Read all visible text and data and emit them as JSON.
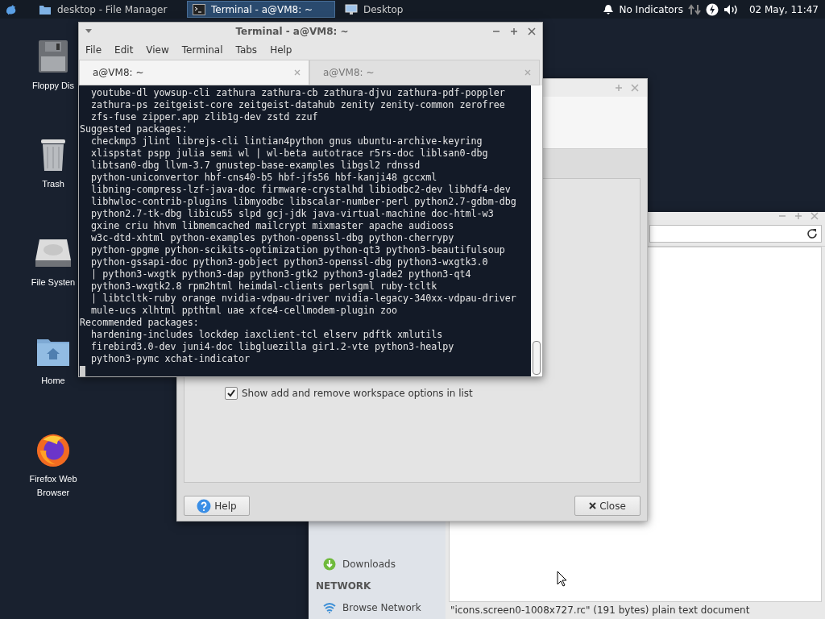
{
  "panel": {
    "tasks": [
      {
        "label": "desktop - File Manager",
        "kind": "folder",
        "selected": false
      },
      {
        "label": "Terminal - a@VM8: ~",
        "kind": "terminal",
        "selected": true
      },
      {
        "label": "Desktop",
        "kind": "desktop",
        "selected": false
      }
    ],
    "indicators": "No Indicators",
    "clock": "02 May, 11:47"
  },
  "desktop_icons": [
    {
      "label": "Floppy Dis",
      "kind": "floppy"
    },
    {
      "label": "Trash",
      "kind": "trash"
    },
    {
      "label": "File Systen",
      "kind": "disk"
    },
    {
      "label": "Home",
      "kind": "home"
    },
    {
      "label": "Firefox Web Browser",
      "kind": "browser"
    }
  ],
  "file_manager": {
    "sidebar": [
      {
        "label": "Downloads",
        "kind": "download"
      },
      {
        "label": "NETWORK",
        "kind": "heading"
      },
      {
        "label": "Browse Network",
        "kind": "network"
      }
    ],
    "status_bar": "\"icons.screen0-1008x727.rc\" (191 bytes) plain text document"
  },
  "settings": {
    "options": [
      {
        "label": "Show add and remove workspace options in list",
        "checked": true
      }
    ],
    "buttons": [
      {
        "label": "Help",
        "kind": "help"
      },
      {
        "label": "Close",
        "kind": "close"
      }
    ]
  },
  "terminal": {
    "title": "Terminal - a@VM8: ~",
    "menu": [
      "File",
      "Edit",
      "View",
      "Terminal",
      "Tabs",
      "Help"
    ],
    "tabs": [
      {
        "label": "a@VM8: ~",
        "selected": true
      },
      {
        "label": "a@VM8: ~",
        "selected": false
      }
    ],
    "lines": [
      "  youtube-dl yowsup-cli zathura zathura-cb zathura-djvu zathura-pdf-poppler",
      "  zathura-ps zeitgeist-core zeitgeist-datahub zenity zenity-common zerofree",
      "  zfs-fuse zipper.app zlib1g-dev zstd zzuf",
      "Suggested packages:",
      "  checkmp3 jlint librejs-cli lintian4python gnus ubuntu-archive-keyring",
      "  xlispstat pspp julia semi wl | wl-beta autotrace r5rs-doc liblsan0-dbg",
      "  libtsan0-dbg llvm-3.7 gnustep-base-examples libgsl2 rdnssd",
      "  python-uniconvertor hbf-cns40-b5 hbf-jfs56 hbf-kanji48 gccxml",
      "  libning-compress-lzf-java-doc firmware-crystalhd libiodbc2-dev libhdf4-dev",
      "  libhwloc-contrib-plugins libmyodbc libscalar-number-perl python2.7-gdbm-dbg",
      "  python2.7-tk-dbg libicu55 slpd gcj-jdk java-virtual-machine doc-html-w3",
      "  gxine criu hhvm libmemcached mailcrypt mixmaster apache audiooss",
      "  w3c-dtd-xhtml python-examples python-openssl-dbg python-cherrypy",
      "  python-gpgme python-scikits-optimization python-qt3 python3-beautifulsoup",
      "  python-gssapi-doc python3-gobject python3-openssl-dbg python3-wxgtk3.0",
      "  | python3-wxgtk python3-dap python3-gtk2 python3-glade2 python3-qt4",
      "  python3-wxgtk2.8 rpm2html heimdal-clients perlsgml ruby-tcltk",
      "  | libtcltk-ruby orange nvidia-vdpau-driver nvidia-legacy-340xx-vdpau-driver",
      "  mule-ucs xlhtml ppthtml uae xfce4-cellmodem-plugin zoo",
      "Recommended packages:",
      "  hardening-includes lockdep iaxclient-tcl elserv pdftk xmlutils",
      "  firebird3.0-dev juni4-doc libgluezilla gir1.2-vte python3-healpy",
      "  python3-pymc xchat-indicator"
    ]
  }
}
